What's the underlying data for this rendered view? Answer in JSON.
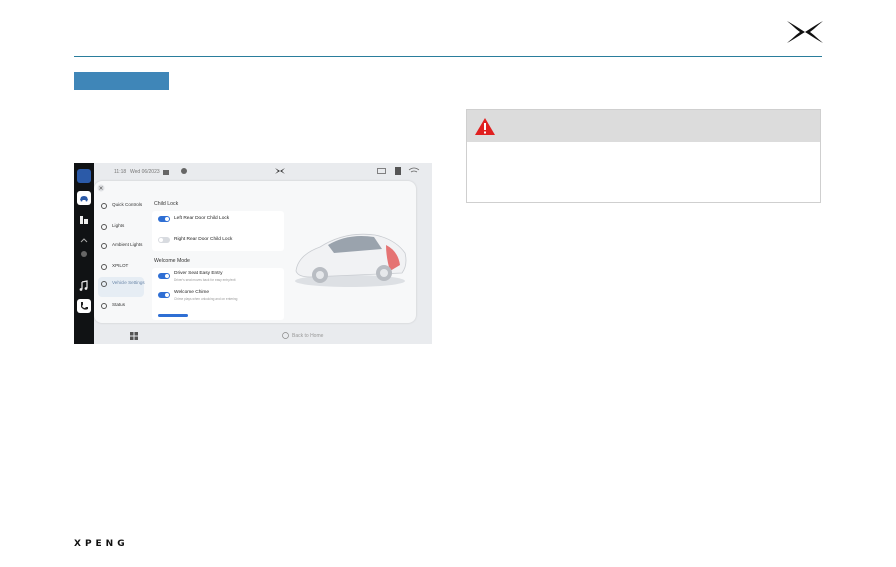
{
  "brand": {
    "footer_wordmark": "XPENG",
    "logo_icon": "xpeng-x-logo-icon"
  },
  "colors": {
    "rule": "#2a7d9c",
    "section_tab": "#3f86b8",
    "warning_red": "#e02020",
    "toggle_on": "#2f6fd4"
  },
  "screen": {
    "status": {
      "time": "11:18",
      "date": "Wed 06/2023"
    },
    "menu": [
      {
        "label": "Quick Controls",
        "active": false
      },
      {
        "label": "Lights",
        "active": false
      },
      {
        "label": "Ambient Lights",
        "active": false
      },
      {
        "label": "XPILOT",
        "active": false
      },
      {
        "label": "Vehicle Settings",
        "active": true
      },
      {
        "label": "Status",
        "active": false
      }
    ],
    "child_lock": {
      "title": "Child Lock",
      "rows": [
        {
          "label": "Left Rear Door Child Lock",
          "on": true
        },
        {
          "label": "Right Rear Door Child Lock",
          "on": false
        }
      ]
    },
    "welcome_mode": {
      "title": "Welcome Mode",
      "rows": [
        {
          "label": "Driver Seat Easy Entry",
          "sub": "Driver's seat moves back for easy entry/exit",
          "on": true
        },
        {
          "label": "Welcome Chime",
          "sub": "Chime plays when unlocking and on entering",
          "on": true
        }
      ]
    },
    "bottom": {
      "hint": "Back to Home"
    }
  }
}
